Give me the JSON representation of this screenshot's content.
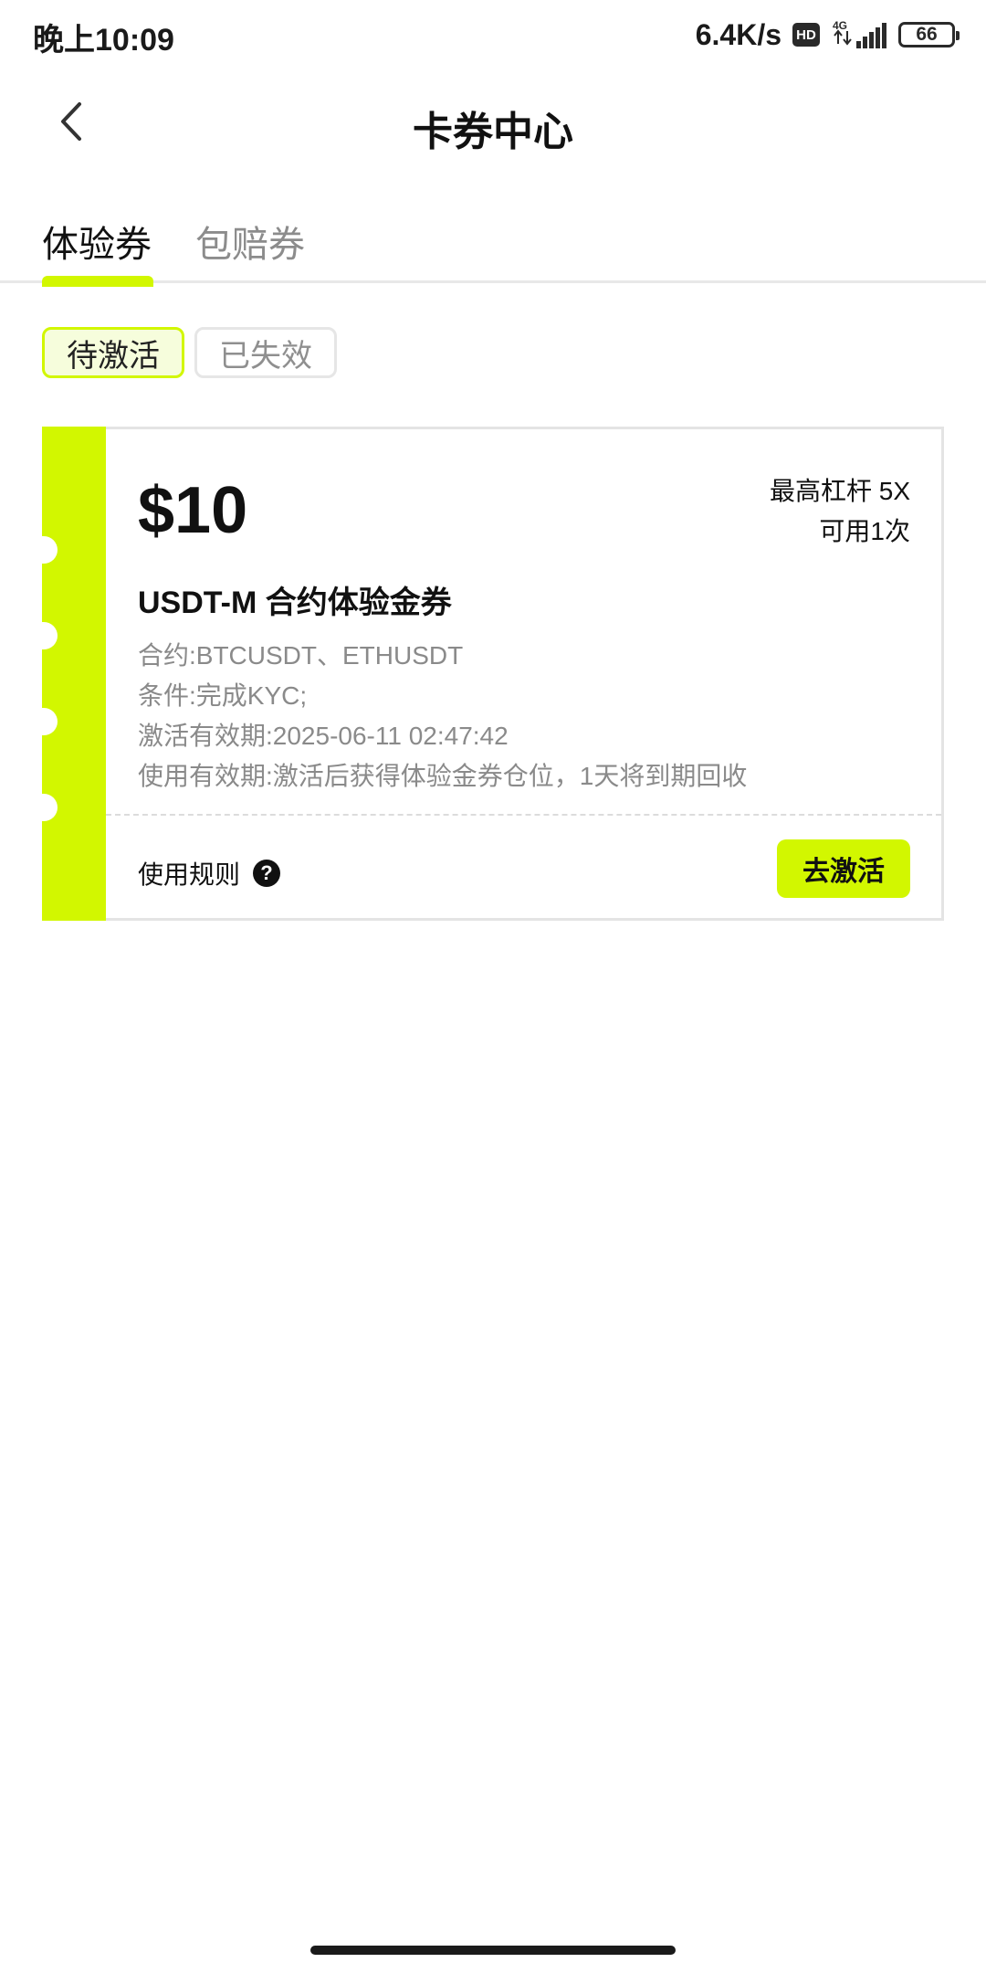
{
  "status_bar": {
    "time": "晚上10:09",
    "net_speed": "6.4K/s",
    "hd_badge": "HD",
    "network_type": "4G",
    "battery": "66"
  },
  "header": {
    "title": "卡券中心",
    "back_icon": "chevron-left-icon"
  },
  "tabs": [
    {
      "label": "体验券",
      "active": true
    },
    {
      "label": "包赔券",
      "active": false
    }
  ],
  "filters": [
    {
      "label": "待激活",
      "active": true
    },
    {
      "label": "已失效",
      "active": false
    }
  ],
  "coupon": {
    "amount": "$10",
    "leverage": "最高杠杆 5X",
    "uses": "可用1次",
    "name": "USDT-M 合约体验金券",
    "details": [
      "合约:BTCUSDT、ETHUSDT",
      "条件:完成KYC;",
      "激活有效期:2025-06-11 02:47:42",
      "使用有效期:激活后获得体验金券仓位，1天将到期回收"
    ],
    "rules_label": "使用规则",
    "help_icon_glyph": "?",
    "action_label": "去激活"
  },
  "colors": {
    "accent": "#d2f700",
    "chip_active_bg": "#f6fddc",
    "muted_text": "#8a8a8a",
    "border": "#e4e4e4"
  }
}
